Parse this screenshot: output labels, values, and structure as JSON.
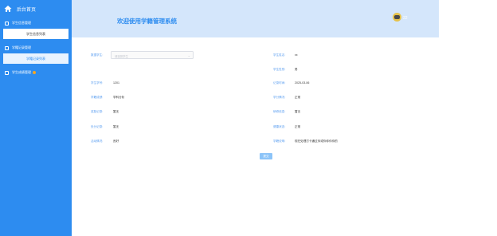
{
  "brand": {
    "title": "后台首页"
  },
  "sidebar": {
    "groups": [
      {
        "label": "学生信息管理"
      },
      {
        "label": "学籍记录管理"
      },
      {
        "label": "学生成绩管理"
      }
    ],
    "subitems": [
      {
        "label": "学生信息列表"
      },
      {
        "label": "学籍记录列表"
      }
    ]
  },
  "header": {
    "title": "欢迎使用学籍管理系统",
    "user": "22"
  },
  "form": {
    "select_label": "数据学生:",
    "select_placeholder": "请选择学生",
    "student_name_label": "学生姓名:",
    "student_name_value": "xx",
    "student_gender_label": "学生性别:",
    "student_gender_value": "男",
    "student_id_label": "学生学号:",
    "student_id_value": "1201",
    "record_time_label": "记录时间:",
    "record_time_value": "2025-03-06",
    "grade_label": "学籍成绩:",
    "grade_value": "学科分析",
    "credit_label": "学分情况:",
    "credit_value": "正常",
    "reward_label": "奖励记录:",
    "reward_value": "暂无",
    "research_label": "研修信息:",
    "research_value": "暂无",
    "punish_label": "处分记录:",
    "punish_value": "暂无",
    "health_label": "健康状态:",
    "health_value": "正常",
    "activity_label": "活动情况:",
    "activity_value": "良好",
    "note_label": "学籍说明:",
    "note_value": "现在处理打卡通过你或你你你你的",
    "submit_label": "提交"
  }
}
